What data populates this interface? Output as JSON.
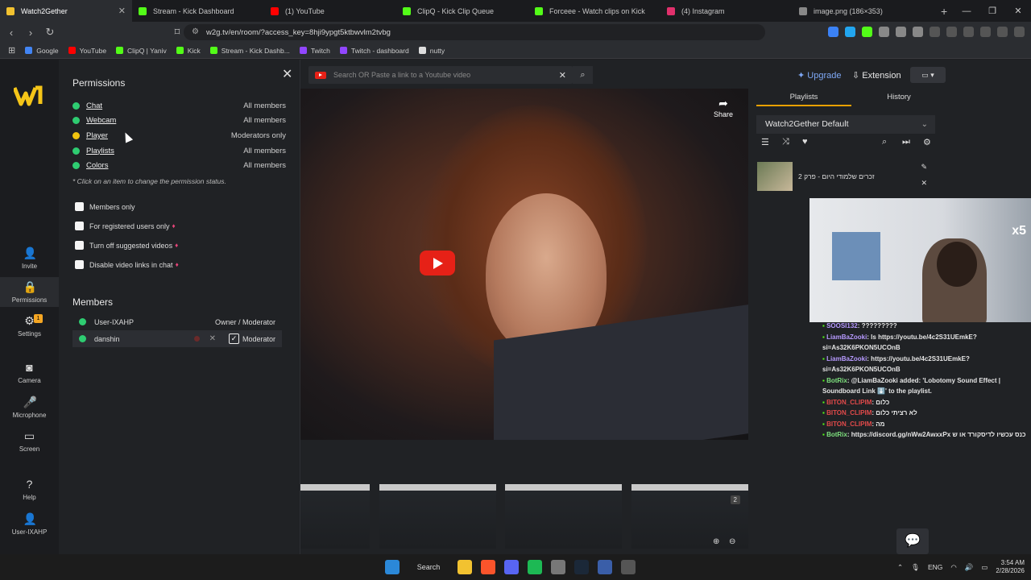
{
  "browser": {
    "tabs": [
      {
        "label": "Watch2Gether",
        "color": "#f2c230",
        "active": true
      },
      {
        "label": "Stream - Kick Dashboard",
        "color": "#53fc18"
      },
      {
        "label": "(1) YouTube",
        "color": "#ff0000"
      },
      {
        "label": "ClipQ - Kick Clip Queue",
        "color": "#53fc18"
      },
      {
        "label": "Forceee - Watch clips on Kick",
        "color": "#53fc18"
      },
      {
        "label": "(4) Instagram",
        "color": "#e1306c"
      },
      {
        "label": "image.png (186×353)",
        "color": "#888888"
      }
    ],
    "url": "w2g.tv/en/room/?access_key=8hji9ypgt5ktbwvlm2tvbg",
    "bookmarks": [
      {
        "label": "Google",
        "color": "#4285f4"
      },
      {
        "label": "YouTube",
        "color": "#ff0000"
      },
      {
        "label": "ClipQ | Yaniv",
        "color": "#53fc18"
      },
      {
        "label": "Kick",
        "color": "#53fc18"
      },
      {
        "label": "Stream - Kick Dashb...",
        "color": "#53fc18"
      },
      {
        "label": "Twitch",
        "color": "#9146ff"
      },
      {
        "label": "Twitch - dashboard",
        "color": "#9146ff"
      },
      {
        "label": "nutty",
        "color": "#dddddd"
      }
    ]
  },
  "nav": {
    "invite": "Invite",
    "permissions": "Permissions",
    "permissions_badge": "1",
    "settings": "Settings",
    "camera": "Camera",
    "microphone": "Microphone",
    "screen": "Screen",
    "help": "Help",
    "user": "User-IXAHP"
  },
  "permissions": {
    "title": "Permissions",
    "items": [
      {
        "name": "Chat",
        "value": "All members",
        "dot": "#2ecc71"
      },
      {
        "name": "Webcam",
        "value": "All members",
        "dot": "#2ecc71"
      },
      {
        "name": "Player",
        "value": "Moderators only",
        "dot": "#f1c40f"
      },
      {
        "name": "Playlists",
        "value": "All members",
        "dot": "#2ecc71"
      },
      {
        "name": "Colors",
        "value": "All members",
        "dot": "#2ecc71"
      }
    ],
    "hint": "* Click on an item to change the permission status.",
    "options": [
      {
        "label": "Members only",
        "premium": false
      },
      {
        "label": "For registered users only",
        "premium": true
      },
      {
        "label": "Turn off suggested videos",
        "premium": true
      },
      {
        "label": "Disable video links in chat",
        "premium": true
      }
    ]
  },
  "members": {
    "title": "Members",
    "list": [
      {
        "name": "User-IXAHP",
        "role": "Owner / Moderator"
      },
      {
        "name": "danshin",
        "role": "Moderator"
      }
    ]
  },
  "search": {
    "placeholder": "Search OR Paste a link to a Youtube video"
  },
  "video": {
    "share": "Share"
  },
  "thumb_badge": "2",
  "top_right": {
    "upgrade": "Upgrade",
    "extension": "Extension"
  },
  "right": {
    "tabs": [
      "Playlists",
      "History"
    ],
    "playlist_name": "Watch2Gether Default",
    "playlist_item": "זכרים שלמודי היום - פרק 2"
  },
  "chat": [
    {
      "user": "SOOSI132",
      "user_color": "#b79aff",
      "text": ": ?????????"
    },
    {
      "user": "LiamBaZooki",
      "user_color": "#b79aff",
      "text": ": ls https://youtu.be/4c2S31UEmkE?si=As32K6PKON5UCOnB"
    },
    {
      "user": "LiamBaZooki",
      "user_color": "#b79aff",
      "text": ": https://youtu.be/4c2S31UEmkE?si=As32K6PKON5UCOnB"
    },
    {
      "user": "BotRix",
      "user_color": "#7ee07e",
      "text": ": @LiamBaZooki added: 'Lobotomy Sound Effect | Soundboard Link ⬇️' to the playlist."
    },
    {
      "user": "BITON_CLIPIM",
      "user_color": "#e24a4a",
      "text": ": כלום"
    },
    {
      "user": "BITON_CLIPIM",
      "user_color": "#e24a4a",
      "text": ": לא רציתי כלום"
    },
    {
      "user": "BITON_CLIPIM",
      "user_color": "#e24a4a",
      "text": ": מה"
    },
    {
      "user": "BotRix",
      "user_color": "#7ee07e",
      "text": ": https://discord.gg/nWw2AwxxPx כנס עכשיו לדיסקורד או ש"
    }
  ],
  "webcam_overlay": "x5",
  "taskbar": {
    "search": "Search",
    "lang": "ENG",
    "time": "3:54 AM",
    "date": "2/28/2026"
  }
}
